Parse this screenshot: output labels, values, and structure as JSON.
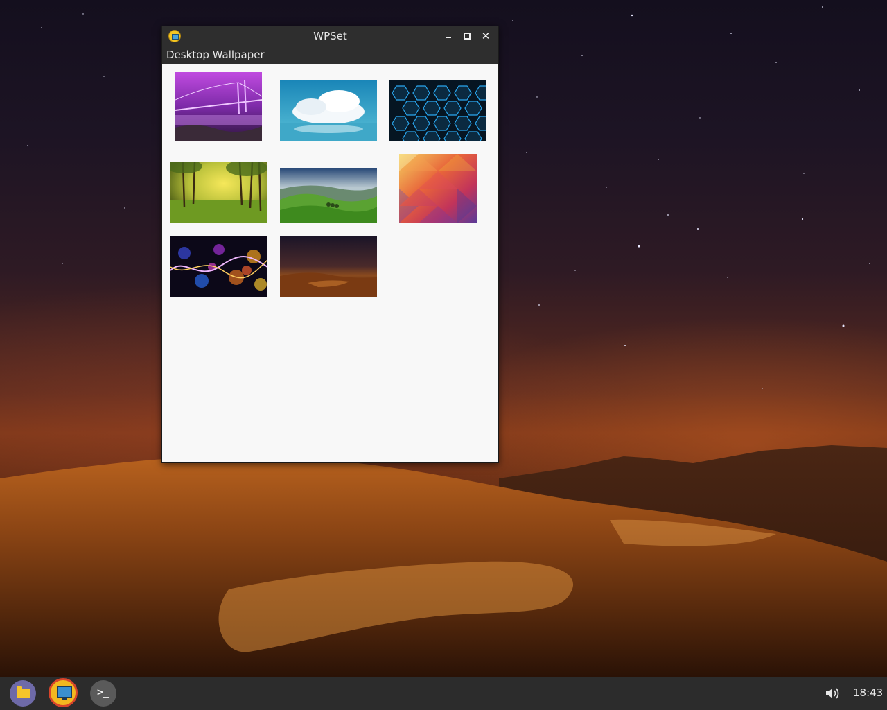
{
  "window": {
    "title": "WPSet",
    "menu": [
      "Desktop Wallpaper"
    ]
  },
  "wallpapers": [
    {
      "name": "purple-bridge-night",
      "accent": "#9b2fc0"
    },
    {
      "name": "white-clouds-over-sea",
      "accent": "#2e8fb8"
    },
    {
      "name": "blue-hexagon-grid",
      "accent": "#1a8ad8"
    },
    {
      "name": "sunlit-forest-meadow",
      "accent": "#8fa62a"
    },
    {
      "name": "green-rolling-hills",
      "accent": "#5f9e2f"
    },
    {
      "name": "geometric-triangles",
      "accent": "#d8484f"
    },
    {
      "name": "bokeh-light-waves",
      "accent": "#c035d0"
    },
    {
      "name": "night-desert-dunes",
      "accent": "#a8561c"
    }
  ],
  "taskbar": {
    "launchers": [
      "files-icon",
      "wpset-icon",
      "terminal-icon"
    ],
    "active_launcher": "wpset-icon",
    "clock": "18:43"
  }
}
